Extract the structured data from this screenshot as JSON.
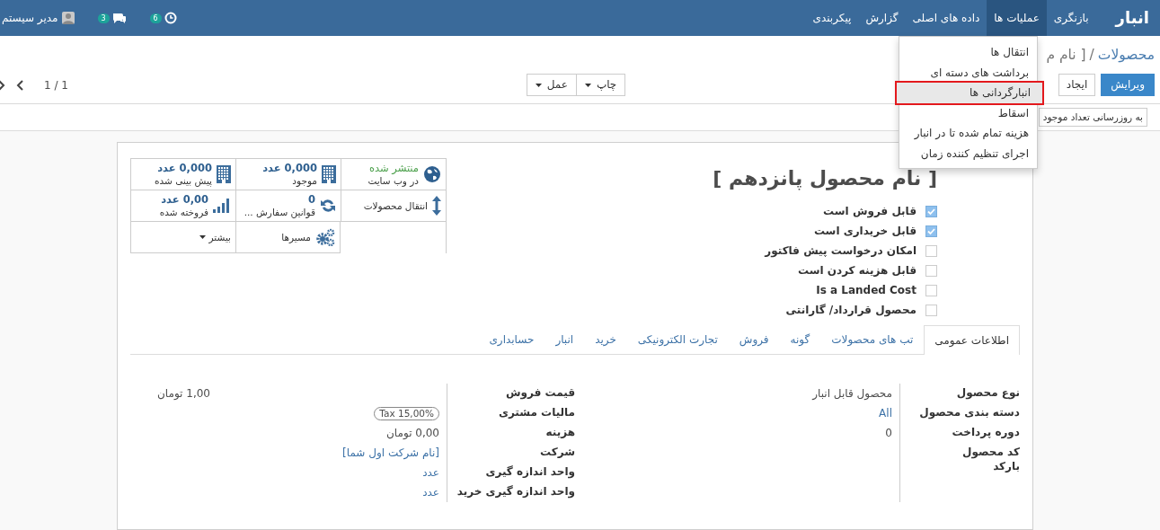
{
  "navbar": {
    "brand": "انبار",
    "menus": [
      {
        "label": "بازنگری",
        "selected": false
      },
      {
        "label": "عملیات ها",
        "selected": true
      },
      {
        "label": "داده های اصلی",
        "selected": false
      },
      {
        "label": "گزارش",
        "selected": false
      },
      {
        "label": "پیکربندی",
        "selected": false
      }
    ],
    "user": "مدیر سیستم",
    "messages_badge": "3",
    "activities_badge": "6"
  },
  "menu_dropdown": [
    {
      "label": "انتقال ها",
      "selected": false
    },
    {
      "label": "برداشت های دسته ای",
      "selected": false
    },
    {
      "label": "انبارگردانی ها",
      "selected": true
    },
    {
      "label": "اسقاط",
      "selected": false
    },
    {
      "label": "هزینه تمام شده تا در انبار",
      "selected": false
    },
    {
      "label": "اجرای تنظیم کننده زمان",
      "selected": false
    }
  ],
  "breadcrumb": {
    "parent": "محصولات",
    "separator": "/",
    "current": "[ نام م"
  },
  "edit_button": "ویرایش",
  "create_button": "ایجاد",
  "action_menus": [
    {
      "label": "چاپ"
    },
    {
      "label": "عمل"
    }
  ],
  "pager": "1 / 1",
  "header_buttons": [
    "به روزرسانی تعداد موجود"
  ],
  "stat_buttons": [
    {
      "kind": "website",
      "value": "منتشر شده",
      "label": "در وب سایت"
    },
    {
      "kind": "on_hand",
      "value": "0,000 عدد",
      "label": "موجود"
    },
    {
      "kind": "forecast",
      "value": "0,000 عدد",
      "label": "پیش بینی شده"
    },
    {
      "kind": "moves",
      "label": "انتقال محصولات"
    },
    {
      "kind": "reordering",
      "value": "0",
      "label": "قوانین سفارش ..."
    },
    {
      "kind": "sold",
      "value": "0,00 عدد",
      "label": "فروخته شده"
    },
    {
      "kind": "routes",
      "label": "مسیرها"
    },
    {
      "kind": "more",
      "label": "بیشتر"
    }
  ],
  "title": "[ نام محصول پانزدهم ]",
  "options": [
    {
      "label": "قابل فروش است",
      "checked": true
    },
    {
      "label": "قابل خریداری است",
      "checked": true
    },
    {
      "label": "امکان درخواست پیش فاکتور",
      "checked": false
    },
    {
      "label": "قابل هزینه کردن است",
      "checked": false
    },
    {
      "label": "Is a Landed Cost",
      "checked": false
    },
    {
      "label": "محصول قرارداد/ گارانتی",
      "checked": false
    }
  ],
  "tabs": [
    {
      "label": "اطلاعات عمومی",
      "selected": true
    },
    {
      "label": "تب های محصولات",
      "selected": false
    },
    {
      "label": "گونه",
      "selected": false
    },
    {
      "label": "فروش",
      "selected": false
    },
    {
      "label": "تجارت الکترونیکی",
      "selected": false
    },
    {
      "label": "خرید",
      "selected": false
    },
    {
      "label": "انبار",
      "selected": false
    },
    {
      "label": "حسابداری",
      "selected": false
    }
  ],
  "field_groups": [
    [
      {
        "label": "نوع محصول",
        "kind": "text",
        "value": "محصول قابل انبار"
      },
      {
        "label": "دسته بندی محصول",
        "kind": "link",
        "value": "All"
      },
      {
        "label": "دوره پرداخت",
        "kind": "text",
        "value": "0"
      },
      {
        "label": "کد محصول",
        "kind": "text"
      },
      {
        "label": "بارکد",
        "kind": "text"
      }
    ],
    [
      {
        "label": "قیمت فروش",
        "kind": "price",
        "value": "1,00 تومان"
      },
      {
        "label": "مالیات مشتری",
        "kind": "tag",
        "value": "Tax 15,00%"
      },
      {
        "label": "هزینه",
        "kind": "text",
        "value": "0,00 تومان"
      },
      {
        "label": "شرکت",
        "kind": "link",
        "value": "[نام شرکت اول شما]"
      },
      {
        "label": "واحد اندازه گیری",
        "kind": "link",
        "value": "عدد"
      },
      {
        "label": "واحد اندازه گیری خرید",
        "kind": "link",
        "value": "عدد"
      }
    ]
  ]
}
